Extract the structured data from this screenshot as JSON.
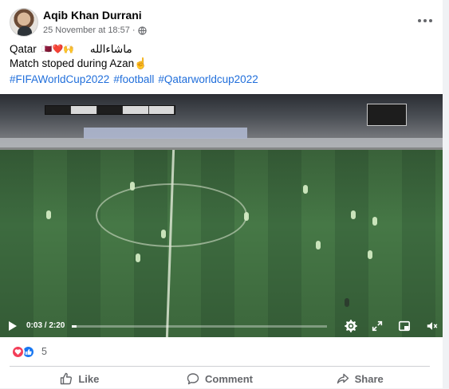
{
  "post": {
    "author": "Aqib Khan Durrani",
    "timestamp": "25 November at 18:57",
    "separator": "·",
    "text_line1": "Qatar",
    "emoji_line1": "🇶🇦❤️🙌",
    "arabic_text": "ماشاءالله",
    "text_line2": "Match stoped during Azan☝️",
    "hashtags": [
      "#FIFAWorldCup2022",
      "#football",
      "#Qatarworldcup2022"
    ]
  },
  "video": {
    "current_time": "0:03",
    "duration": "2:20",
    "time_display": "0:03 / 2:20",
    "progress": 0.02
  },
  "reactions": {
    "count": "5",
    "types": [
      "love",
      "like"
    ]
  },
  "actions": {
    "like_label": "Like",
    "comment_label": "Comment",
    "share_label": "Share"
  },
  "icons": {
    "privacy": "globe-icon",
    "menu": "more-options-icon",
    "play": "play-icon",
    "settings": "settings-icon",
    "fullscreen": "fullscreen-icon",
    "pip": "picture-in-picture-icon",
    "volume": "volume-icon",
    "like": "thumbs-up-icon",
    "comment": "comment-icon",
    "share": "share-icon"
  },
  "colors": {
    "link": "#216fdb",
    "like_blue": "#1877f2",
    "love_red": "#f33e58",
    "secondary_text": "#65676b"
  }
}
